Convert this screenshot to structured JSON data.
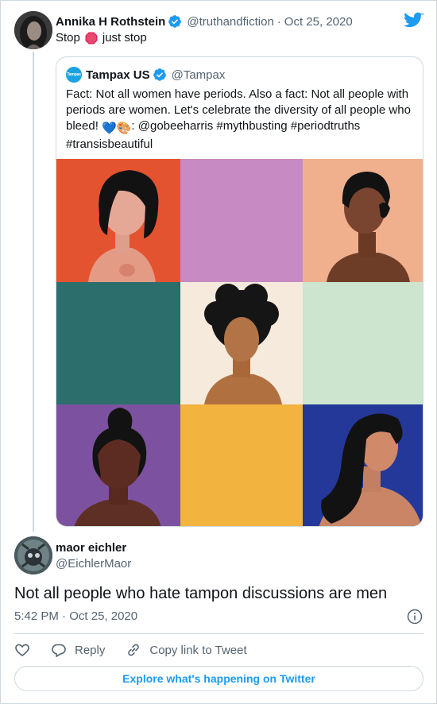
{
  "parent_tweet": {
    "author_name": "Annika H Rothstein",
    "author_handle": "@truthandfiction",
    "separator": "·",
    "date": "Oct 25, 2020",
    "text_before": "Stop",
    "text_emoji": "stop-sign-icon",
    "text_after": "just stop"
  },
  "quoted_tweet": {
    "author_name": "Tampax US",
    "author_handle": "@Tampax",
    "logo_text": "Tampax",
    "text_line1": "Fact: Not all women have periods. Also a fact: Not all people with periods are women. Let's celebrate the diversity of all people who bleed!",
    "text_line2": ": @gobeeharris #mythbusting #periodtruths #transisbeautiful",
    "emoji_heart": "💙",
    "emoji_palette": "🎨",
    "image_tiles": [
      {
        "bg": "#e4532f"
      },
      {
        "bg": "#c78ac3"
      },
      {
        "bg": "#f1b08d"
      },
      {
        "bg": "#2b6e6b"
      },
      {
        "bg": "#f6eadd"
      },
      {
        "bg": "#cde5cf"
      },
      {
        "bg": "#7c52a0"
      },
      {
        "bg": "#f2b33f"
      },
      {
        "bg": "#243899"
      }
    ]
  },
  "reply_tweet": {
    "author_name": "maor eichler",
    "author_handle": "@EichlerMaor",
    "text": "Not all people who hate tampon discussions are men",
    "time": "5:42 PM",
    "separator": "·",
    "date": "Oct 25, 2020"
  },
  "actions": {
    "like_icon": "heart-icon",
    "reply_label": "Reply",
    "copy_label": "Copy link to Tweet"
  },
  "explore": {
    "label": "Explore what's happening on Twitter"
  },
  "colors": {
    "accent": "#1d9bf0",
    "secondary_text": "#536471",
    "border": "#cfd9de",
    "stop_red": "#e0245e"
  }
}
